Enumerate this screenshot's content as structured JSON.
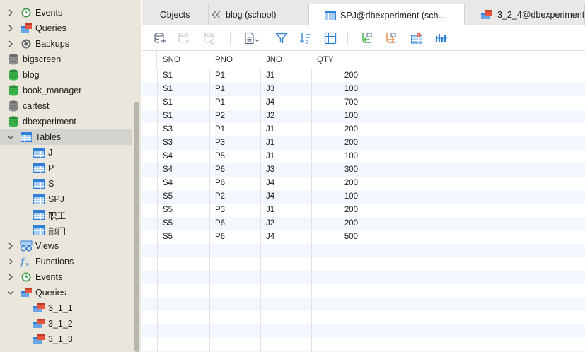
{
  "sidebar": {
    "rows": [
      {
        "label": "Events",
        "icon": "events-clock-icon",
        "chevron": "right",
        "indent": 1
      },
      {
        "label": "Queries",
        "icon": "queries-icon",
        "chevron": "right",
        "indent": 1
      },
      {
        "label": "Backups",
        "icon": "backup-icon",
        "chevron": "right",
        "indent": 1
      },
      {
        "label": "bigscreen",
        "icon": "database-gray-icon",
        "chevron": "",
        "indent": 0
      },
      {
        "label": "blog",
        "icon": "database-green-icon",
        "chevron": "",
        "indent": 0
      },
      {
        "label": "book_manager",
        "icon": "database-green-icon",
        "chevron": "",
        "indent": 0
      },
      {
        "label": "cartest",
        "icon": "database-gray-icon",
        "chevron": "",
        "indent": 0
      },
      {
        "label": "dbexperiment",
        "icon": "database-green-icon",
        "chevron": "",
        "indent": 0
      },
      {
        "label": "Tables",
        "icon": "tables-icon",
        "chevron": "down",
        "indent": 1,
        "selected": true
      },
      {
        "label": "J",
        "icon": "table-icon",
        "chevron": "",
        "indent": 2
      },
      {
        "label": "P",
        "icon": "table-icon",
        "chevron": "",
        "indent": 2
      },
      {
        "label": "S",
        "icon": "table-icon",
        "chevron": "",
        "indent": 2
      },
      {
        "label": "SPJ",
        "icon": "table-icon",
        "chevron": "",
        "indent": 2
      },
      {
        "label": "职工",
        "icon": "table-icon",
        "chevron": "",
        "indent": 2
      },
      {
        "label": "部门",
        "icon": "table-icon",
        "chevron": "",
        "indent": 2
      },
      {
        "label": "Views",
        "icon": "views-icon",
        "chevron": "right",
        "indent": 1
      },
      {
        "label": "Functions",
        "icon": "function-icon",
        "chevron": "right",
        "indent": 1
      },
      {
        "label": "Events",
        "icon": "events-clock-icon",
        "chevron": "right",
        "indent": 1
      },
      {
        "label": "Queries",
        "icon": "queries-icon",
        "chevron": "down",
        "indent": 1
      },
      {
        "label": "3_1_1",
        "icon": "query-icon",
        "chevron": "",
        "indent": 2
      },
      {
        "label": "3_1_2",
        "icon": "query-icon",
        "chevron": "",
        "indent": 2
      },
      {
        "label": "3_1_3",
        "icon": "query-icon",
        "chevron": "",
        "indent": 2
      }
    ]
  },
  "tabs": [
    {
      "label": "Objects",
      "icon": "",
      "active": false
    },
    {
      "label": "blog (school)",
      "icon": "double-chevron-left-icon",
      "active": false
    },
    {
      "label": "SPJ@dbexperiment (sch...",
      "icon": "table-icon",
      "active": true
    },
    {
      "label": "3_2_4@dbexperiment",
      "icon": "query-icon",
      "active": false
    }
  ],
  "toolbar": {
    "buttons": [
      {
        "name": "begin-transaction-icon",
        "enabled": true
      },
      {
        "name": "commit-icon",
        "enabled": false
      },
      {
        "name": "rollback-icon",
        "enabled": false
      },
      {
        "name": "text-view-icon",
        "enabled": true
      },
      {
        "name": "filter-icon",
        "enabled": true
      },
      {
        "name": "sort-icon",
        "enabled": true
      },
      {
        "name": "grid-view-icon",
        "enabled": true
      },
      {
        "name": "import-icon",
        "enabled": true
      },
      {
        "name": "export-icon",
        "enabled": true
      },
      {
        "name": "data-generation-icon",
        "enabled": true
      },
      {
        "name": "chart-icon",
        "enabled": true
      }
    ]
  },
  "grid": {
    "columns": [
      "SNO",
      "PNO",
      "JNO",
      "QTY"
    ],
    "rows": [
      [
        "S1",
        "P1",
        "J1",
        "200"
      ],
      [
        "S1",
        "P1",
        "J3",
        "100"
      ],
      [
        "S1",
        "P1",
        "J4",
        "700"
      ],
      [
        "S1",
        "P2",
        "J2",
        "100"
      ],
      [
        "S3",
        "P1",
        "J1",
        "200"
      ],
      [
        "S3",
        "P3",
        "J1",
        "200"
      ],
      [
        "S4",
        "P5",
        "J1",
        "100"
      ],
      [
        "S4",
        "P6",
        "J3",
        "300"
      ],
      [
        "S4",
        "P6",
        "J4",
        "200"
      ],
      [
        "S5",
        "P2",
        "J4",
        "100"
      ],
      [
        "S5",
        "P3",
        "J1",
        "200"
      ],
      [
        "S5",
        "P6",
        "J2",
        "200"
      ],
      [
        "S5",
        "P6",
        "J4",
        "500"
      ]
    ]
  },
  "colors": {
    "accent": "#2f7fd8",
    "db_green": "#3bb54a",
    "db_gray": "#8e8e8e",
    "query_red": "#e8563f",
    "row_stripe": "#f3f8fe",
    "sidebar_bg": "#ebe6dc",
    "selected_row": "#d4d2ce"
  }
}
